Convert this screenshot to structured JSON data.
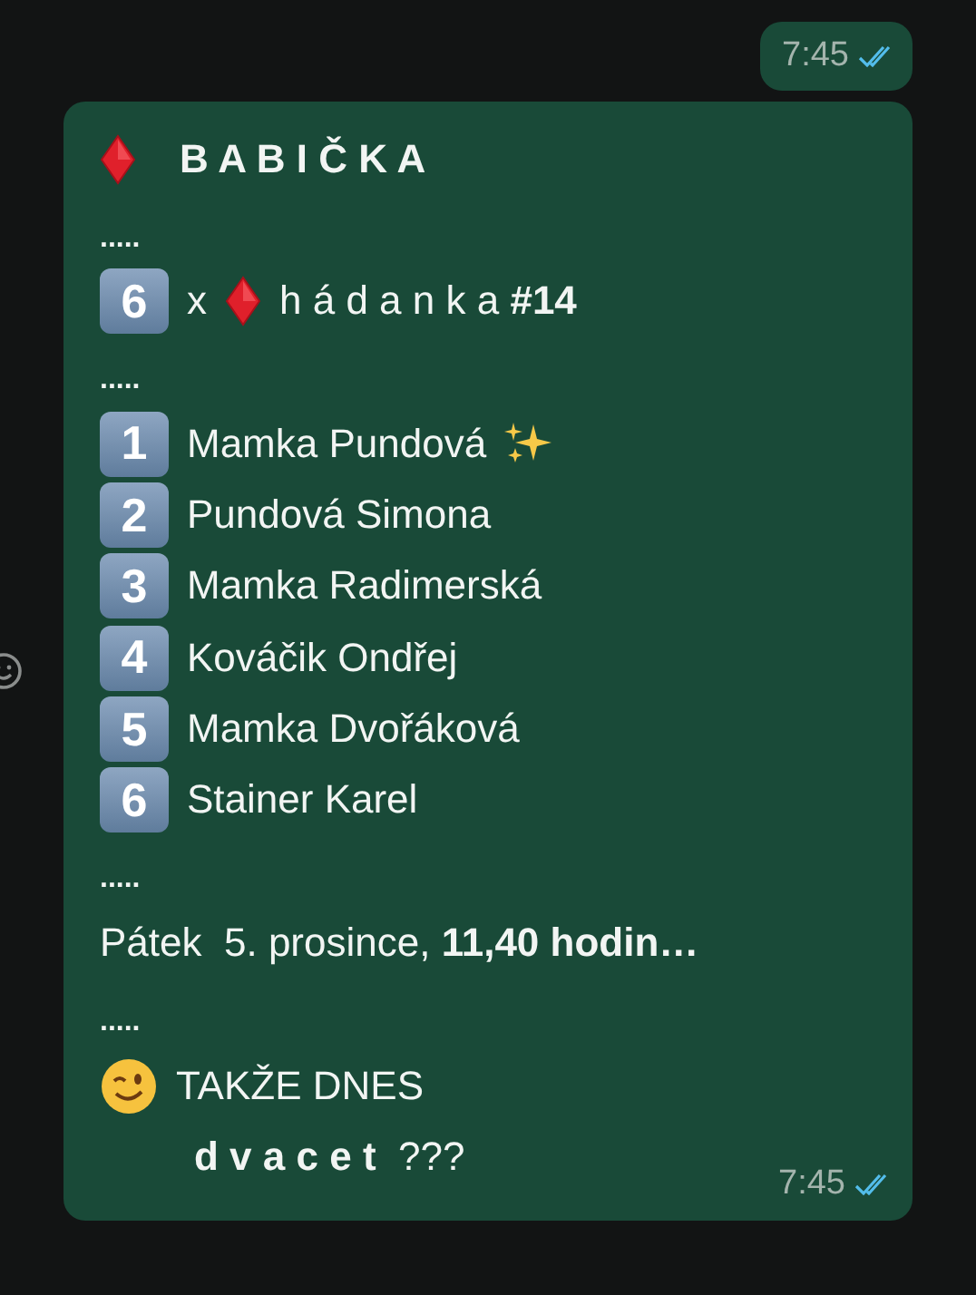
{
  "messages": [
    {
      "kind": "short",
      "time": "7:45",
      "read": true
    },
    {
      "kind": "long",
      "time": "7:45",
      "read": true,
      "lines": [
        {
          "kind": "title",
          "text": "B A B I Č K A"
        },
        {
          "kind": "dots",
          "text": "....."
        },
        {
          "kind": "count",
          "key": "6",
          "x": "x",
          "text": "h á d a n k a **#14**"
        },
        {
          "kind": "dots",
          "text": "....."
        },
        {
          "kind": "item",
          "key": "1",
          "text": "Mamka Pundová",
          "sparkles": true
        },
        {
          "kind": "item",
          "key": "2",
          "text": "Pundová Simona",
          "sparkles": false
        },
        {
          "kind": "item",
          "key": "3",
          "text": "Mamka Radimerská",
          "sparkles": false
        },
        {
          "kind": "item",
          "key": "4",
          "text": "Kováčik Ondřej",
          "sparkles": false
        },
        {
          "kind": "item",
          "key": "5",
          "text": "Mamka Dvořáková",
          "sparkles": false
        },
        {
          "kind": "item",
          "key": "6",
          "text": "Stainer Karel",
          "sparkles": false
        },
        {
          "kind": "dots",
          "text": "....."
        },
        {
          "kind": "plain",
          "text": "Pátek  5. prosince, **11,40 hodin…**"
        },
        {
          "kind": "dots",
          "text": "....."
        },
        {
          "kind": "wink",
          "text": "TAKŽE DNES"
        },
        {
          "kind": "indent",
          "text": "**d v a c e t**  ???"
        }
      ]
    }
  ]
}
